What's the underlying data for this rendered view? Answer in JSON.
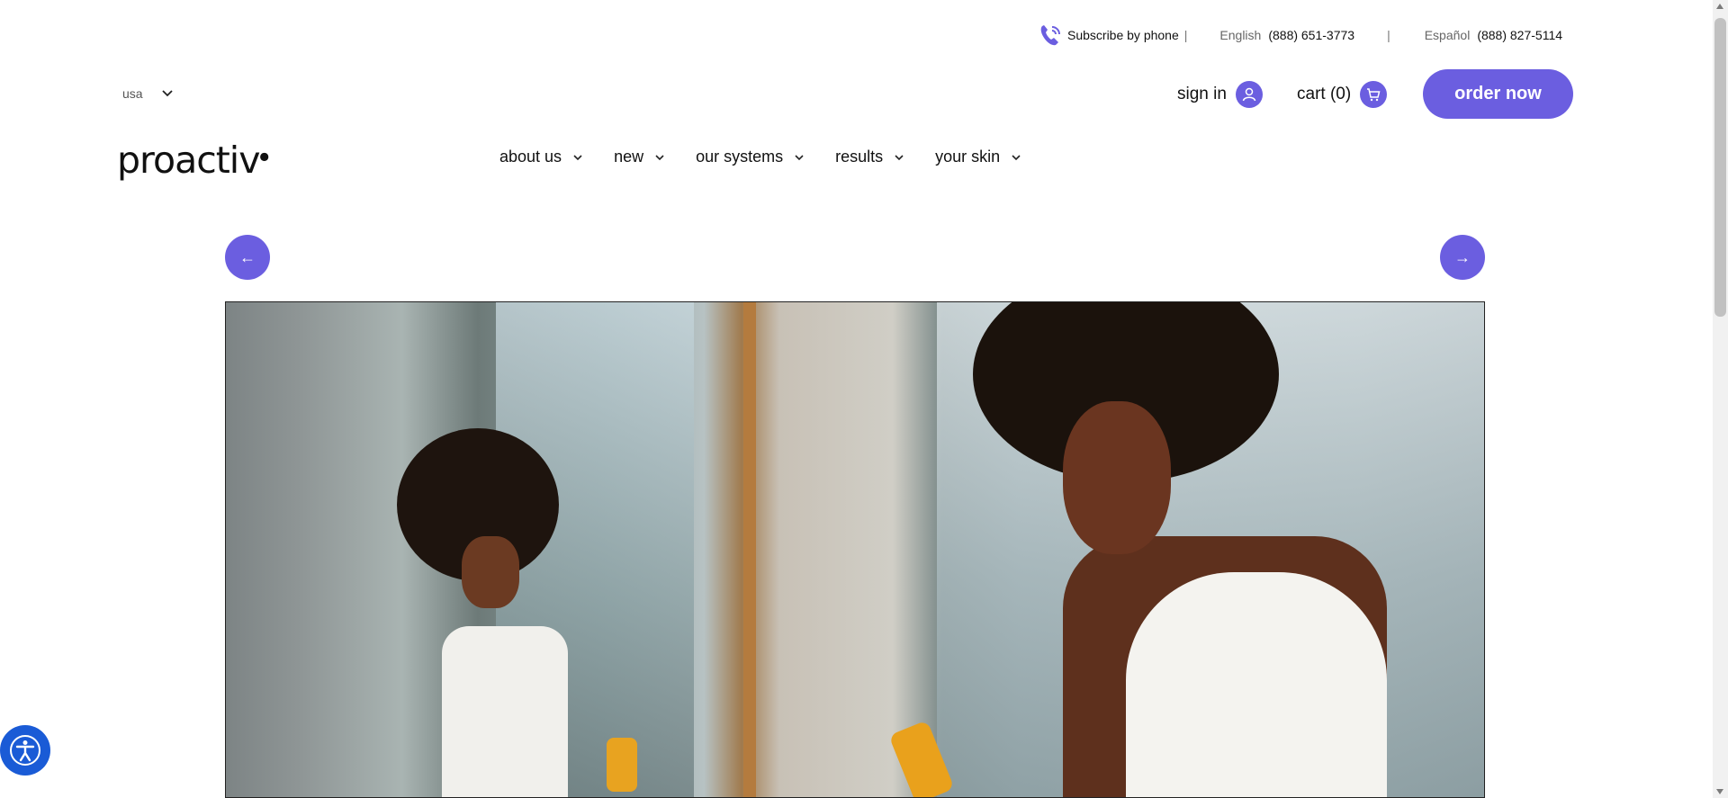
{
  "topbar": {
    "subscribe_label": "Subscribe by phone",
    "separator": "|",
    "english_label": "English",
    "english_number": "(888) 651-3773",
    "spanish_label": "Español",
    "spanish_number": "(888) 827-5114"
  },
  "header": {
    "country": "usa",
    "sign_in": "sign in",
    "cart": "cart (0)",
    "order_now": "order now",
    "logo": "proactiv"
  },
  "nav": {
    "items": [
      {
        "label": "about us"
      },
      {
        "label": "new"
      },
      {
        "label": "our systems"
      },
      {
        "label": "results"
      },
      {
        "label": "your skin"
      }
    ]
  },
  "carousel": {
    "prev": "←",
    "next": "→"
  },
  "colors": {
    "accent": "#6b5ee0",
    "a11y": "#1a5bd6"
  }
}
